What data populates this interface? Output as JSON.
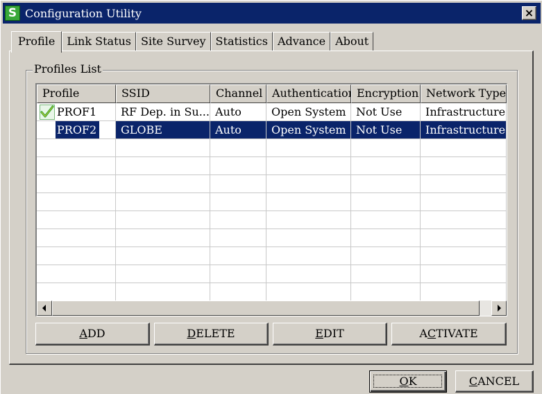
{
  "window": {
    "title": "Configuration Utility",
    "app_icon_letter": "S",
    "close_glyph": "×"
  },
  "tabs": [
    {
      "label": "Profile",
      "active": true
    },
    {
      "label": "Link Status"
    },
    {
      "label": "Site Survey"
    },
    {
      "label": "Statistics"
    },
    {
      "label": "Advance"
    },
    {
      "label": "About"
    }
  ],
  "profiles_group": {
    "label": "Profiles List",
    "columns": [
      "Profile",
      "SSID",
      "Channel",
      "Authentication",
      "Encryption",
      "Network Type"
    ],
    "rows": [
      {
        "profile": "PROF1",
        "ssid": "RF Dep. in Su...",
        "channel": "Auto",
        "authentication": "Open System",
        "encryption": "Not Use",
        "network_type": "Infrastructure",
        "active_icon": "green-check-icon",
        "selected": false
      },
      {
        "profile": "PROF2",
        "ssid": "GLOBE",
        "channel": "Auto",
        "authentication": "Open System",
        "encryption": "Not Use",
        "network_type": "Infrastructure",
        "selected": true
      }
    ]
  },
  "actions": {
    "add": {
      "prefix": "",
      "key": "A",
      "rest": "DD"
    },
    "delete": {
      "prefix": "",
      "key": "D",
      "rest": "ELETE"
    },
    "edit": {
      "prefix": "",
      "key": "E",
      "rest": "DIT"
    },
    "activate": {
      "prefix": "A",
      "key": "C",
      "rest": "TIVATE"
    }
  },
  "dialog": {
    "ok": {
      "prefix": "",
      "key": "O",
      "rest": "K"
    },
    "cancel": {
      "prefix": "",
      "key": "C",
      "rest": "ANCEL"
    }
  },
  "colors": {
    "titlebar": "#0a246a",
    "selection": "#0a246a",
    "face": "#d4d0c8",
    "check": "#2fa82f"
  }
}
